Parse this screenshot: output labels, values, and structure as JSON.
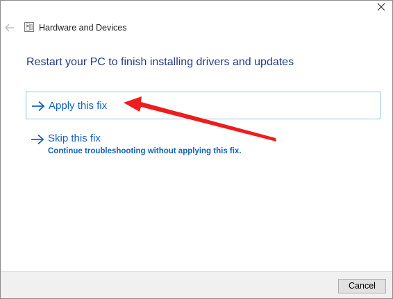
{
  "window": {
    "title": "Hardware and Devices",
    "icons": {
      "close": "close-icon",
      "back": "back-arrow-icon",
      "app": "troubleshooter-icon"
    }
  },
  "main": {
    "heading": "Restart your PC to finish installing drivers and updates",
    "options": [
      {
        "label": "Apply this fix",
        "description": "",
        "icon": "arrow-right-icon"
      },
      {
        "label": "Skip this fix",
        "description": "Continue troubleshooting without applying this fix.",
        "icon": "arrow-right-icon"
      }
    ]
  },
  "footer": {
    "cancel_label": "Cancel"
  },
  "colors": {
    "heading": "#1f3c88",
    "link": "#1060c0",
    "highlight_border": "#8fbfe3",
    "annotation_arrow": "#ee1c1c",
    "footer_bg": "#f0f0f0"
  }
}
